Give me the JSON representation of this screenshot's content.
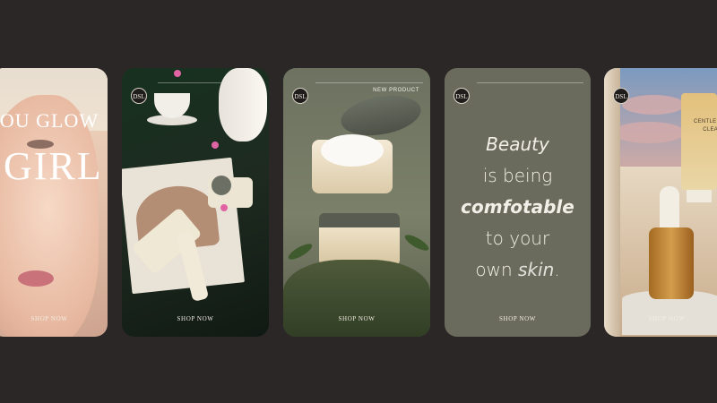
{
  "cards": [
    {
      "title_line1": "OU GLOW",
      "title_line2": "GIRL",
      "cta": "SHOP NOW"
    },
    {
      "cta": "SHOP NOW"
    },
    {
      "label": "NEW PRODUCT",
      "cta": "SHOP NOW"
    },
    {
      "quote": {
        "line1": "Beauty",
        "line2": "is being",
        "line3": "comfotable",
        "line4": "to your",
        "line5_a": "own",
        "line5_b": "skin",
        "line5_c": "."
      },
      "cta": "SHOP NOW"
    },
    {
      "product_text_1": "CENTLE SK",
      "product_text_2": "CLEANS",
      "cta": "SHOP NOW"
    }
  ],
  "logo": {
    "text": "DSL"
  },
  "colors": {
    "background": "#2a2726",
    "olive_card": "#6a6b5c",
    "cream_text": "#f1efe7"
  }
}
